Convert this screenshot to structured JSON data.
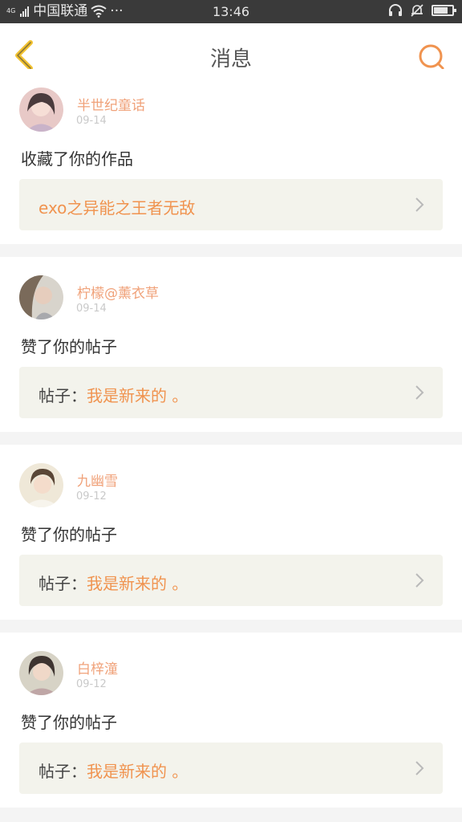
{
  "status_bar": {
    "network": "4G",
    "carrier": "中国联通",
    "more": "···",
    "time": "13:46"
  },
  "header": {
    "title": "消息"
  },
  "messages": [
    {
      "username": "半世纪童话",
      "date": "09-14",
      "action": "收藏了你的作品",
      "link_prefix": "",
      "link_text": "exo之异能之王者无敌"
    },
    {
      "username": "柠檬@薰衣草",
      "date": "09-14",
      "action": "赞了你的帖子",
      "link_prefix": "帖子：",
      "link_text": "我是新来的 。"
    },
    {
      "username": "九幽雪",
      "date": "09-12",
      "action": "赞了你的帖子",
      "link_prefix": "帖子：",
      "link_text": "我是新来的 。"
    },
    {
      "username": "白梓潼",
      "date": "09-12",
      "action": "赞了你的帖子",
      "link_prefix": "帖子：",
      "link_text": "我是新来的 。"
    }
  ],
  "icons": {
    "back": "chevron-left-icon",
    "search": "search-icon",
    "item_arrow": "chevron-right-icon"
  },
  "colors": {
    "accent": "#f0934f",
    "username": "#f0a27a",
    "back_icon": "#f2c230",
    "status_bar": "#3a3a3a",
    "link_box": "#f3f3ec"
  }
}
